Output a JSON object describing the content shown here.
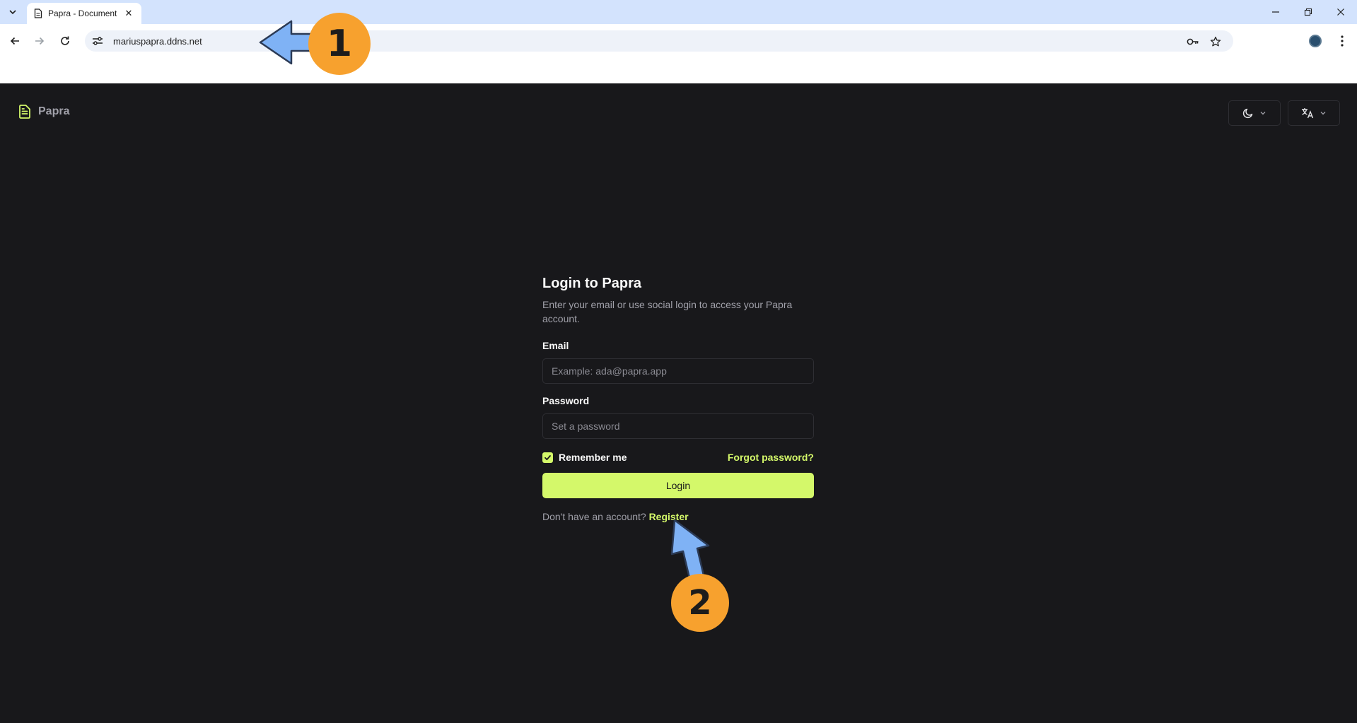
{
  "browser": {
    "tab_title": "Papra - Document",
    "url": "mariuspapra.ddns.net"
  },
  "app": {
    "brand": "Papra",
    "accent_color": "#d4f86a"
  },
  "login": {
    "title": "Login to Papra",
    "subtitle": "Enter your email or use social login to access your Papra account.",
    "email_label": "Email",
    "email_placeholder": "Example: ada@papra.app",
    "password_label": "Password",
    "password_placeholder": "Set a password",
    "remember_label": "Remember me",
    "remember_checked": true,
    "forgot_label": "Forgot password?",
    "login_button": "Login",
    "no_account_text": "Don't have an account?",
    "register_label": "Register"
  },
  "annotations": {
    "step1": "1",
    "step2": "2"
  }
}
